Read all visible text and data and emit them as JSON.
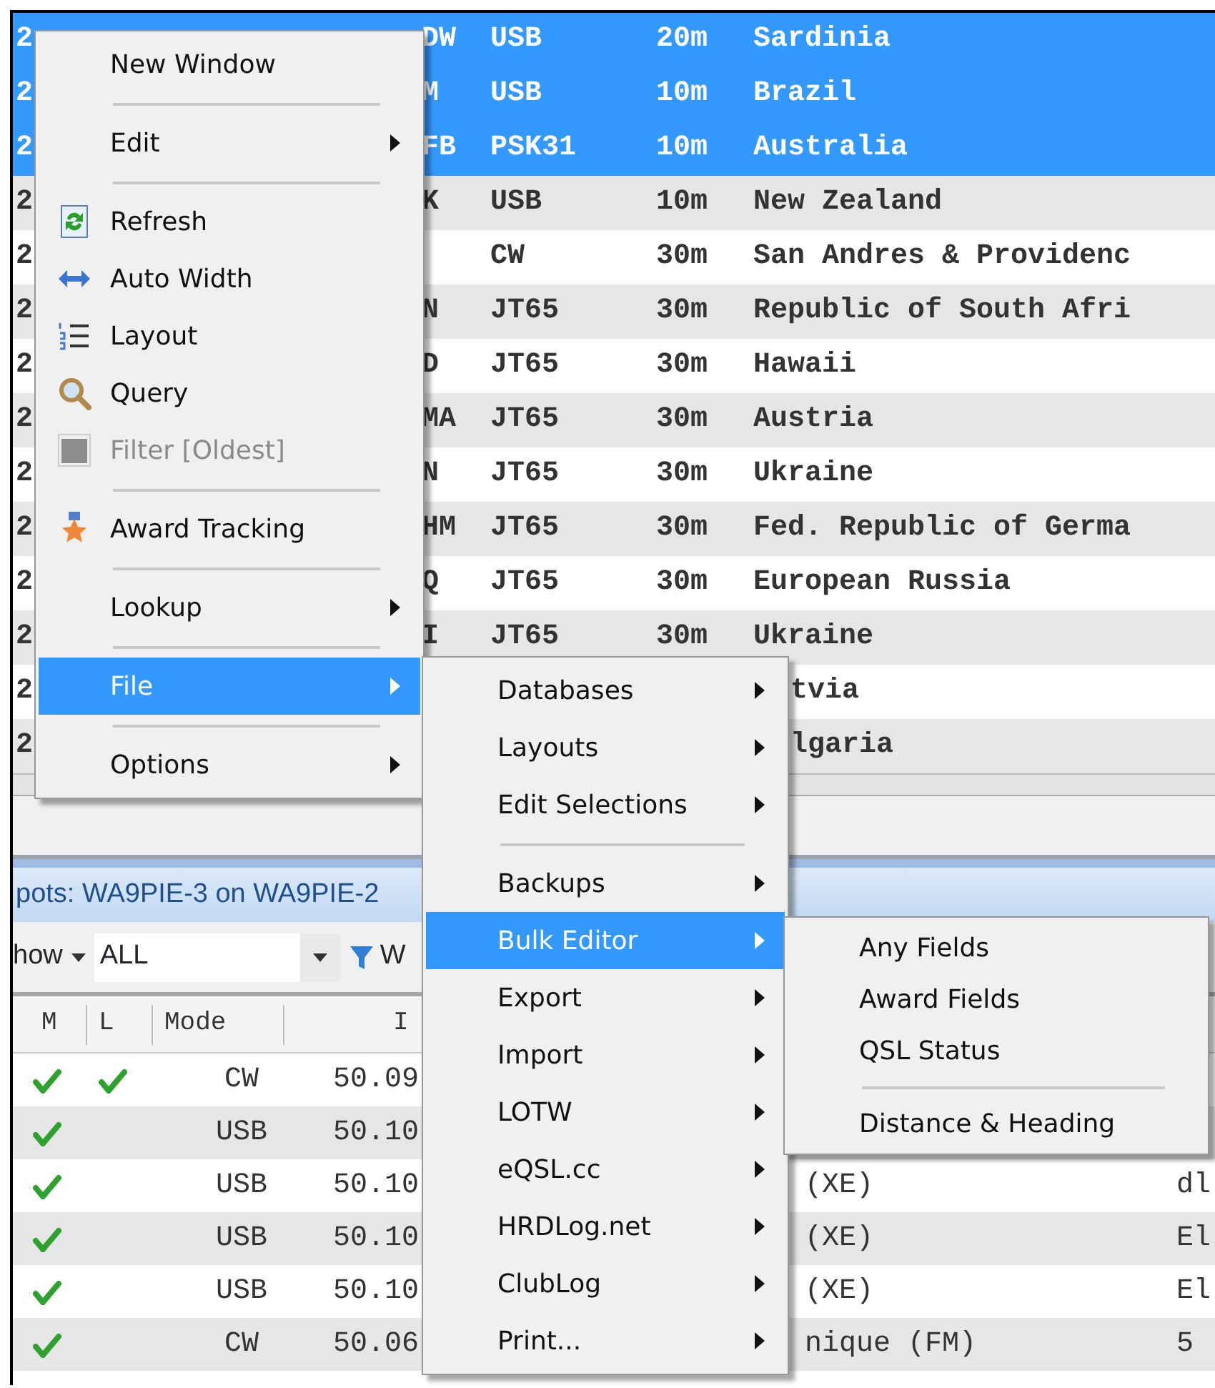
{
  "log_table": {
    "rows": [
      {
        "kind": "full",
        "column_1": "2",
        "call": "DW",
        "mode": "USB",
        "band": "20m",
        "country": "Sardinia",
        "selected": true
      },
      {
        "kind": "full",
        "column_1": "2",
        "call": "M",
        "mode": "USB",
        "band": "10m",
        "country": "Brazil",
        "selected": true
      },
      {
        "kind": "full",
        "column_1": "2",
        "call": "FB",
        "mode": "PSK31",
        "band": "10m",
        "country": "Australia",
        "selected": true
      },
      {
        "kind": "full",
        "column_1": "2",
        "call": "K",
        "mode": "USB",
        "band": "10m",
        "country": "New Zealand",
        "selected": false
      },
      {
        "kind": "full",
        "column_1": "2",
        "call": "",
        "mode": "CW",
        "band": "30m",
        "country": "San Andres & Providenc",
        "selected": false
      },
      {
        "kind": "full",
        "column_1": "2",
        "call": "N",
        "mode": "JT65",
        "band": "30m",
        "country": "Republic of South Afri",
        "selected": false
      },
      {
        "kind": "full",
        "column_1": "2",
        "call": "D",
        "mode": "JT65",
        "band": "30m",
        "country": "Hawaii",
        "selected": false
      },
      {
        "kind": "full",
        "column_1": "2",
        "call": "MA",
        "mode": "JT65",
        "band": "30m",
        "country": "Austria",
        "selected": false
      },
      {
        "kind": "full",
        "column_1": "2",
        "call": "N",
        "mode": "JT65",
        "band": "30m",
        "country": "Ukraine",
        "selected": false
      },
      {
        "kind": "full",
        "column_1": "2",
        "call": "HM",
        "mode": "JT65",
        "band": "30m",
        "country": "Fed. Republic of Germa",
        "selected": false
      },
      {
        "kind": "full",
        "column_1": "2",
        "call": "Q",
        "mode": "JT65",
        "band": "30m",
        "country": "European Russia",
        "selected": false
      },
      {
        "kind": "full",
        "column_1": "2",
        "call": "I",
        "mode": "JT65",
        "band": "30m",
        "country": "Ukraine",
        "selected": false
      },
      {
        "kind": "partial",
        "column_1": "2",
        "country": "tvia",
        "selected": false
      },
      {
        "kind": "partial",
        "column_1": "2",
        "country": "lgaria",
        "selected": false
      }
    ]
  },
  "spots_panel": {
    "title": "pots: WA9PIE-3 on WA9PIE-2",
    "show_label": "how",
    "filter_value": "ALL",
    "filter_button": "W",
    "columns": [
      "M",
      "L",
      "Mode",
      "I"
    ],
    "rows": [
      {
        "m": true,
        "l": true,
        "mode": "CW",
        "freq": "50.09",
        "country": "",
        "column_6": ""
      },
      {
        "m": true,
        "l": false,
        "mode": "USB",
        "freq": "50.10",
        "country": "",
        "column_6": ""
      },
      {
        "m": true,
        "l": false,
        "mode": "USB",
        "freq": "50.10",
        "country": "(XE)",
        "column_6": "dl"
      },
      {
        "m": true,
        "l": false,
        "mode": "USB",
        "freq": "50.10",
        "country": "(XE)",
        "column_6": "El"
      },
      {
        "m": true,
        "l": false,
        "mode": "USB",
        "freq": "50.10",
        "country": "(XE)",
        "column_6": "El"
      },
      {
        "m": true,
        "l": false,
        "mode": "CW",
        "freq": "50.06",
        "country": "nique (FM)",
        "column_6": "5"
      }
    ]
  },
  "menus": [
    {
      "items": [
        {
          "kind": "item",
          "label": "New Window",
          "selected": false,
          "disabled": false,
          "submenu": false
        },
        {
          "kind": "separator"
        },
        {
          "kind": "item",
          "label": "Edit",
          "selected": false,
          "disabled": false,
          "submenu": true
        },
        {
          "kind": "separator"
        },
        {
          "kind": "item",
          "label": "Refresh",
          "selected": false,
          "disabled": false,
          "submenu": false
        },
        {
          "kind": "item",
          "label": "Auto Width",
          "selected": false,
          "disabled": false,
          "submenu": false
        },
        {
          "kind": "item",
          "label": "Layout",
          "selected": false,
          "disabled": false,
          "submenu": false
        },
        {
          "kind": "item",
          "label": "Query",
          "selected": false,
          "disabled": false,
          "submenu": false
        },
        {
          "kind": "item",
          "label": "Filter [Oldest]",
          "selected": false,
          "disabled": true,
          "submenu": false
        },
        {
          "kind": "separator"
        },
        {
          "kind": "item",
          "label": "Award Tracking",
          "selected": false,
          "disabled": false,
          "submenu": false
        },
        {
          "kind": "separator"
        },
        {
          "kind": "item",
          "label": "Lookup",
          "selected": false,
          "disabled": false,
          "submenu": true
        },
        {
          "kind": "separator"
        },
        {
          "kind": "item",
          "label": "File",
          "selected": true,
          "disabled": false,
          "submenu": true
        },
        {
          "kind": "separator"
        },
        {
          "kind": "item",
          "label": "Options",
          "selected": false,
          "disabled": false,
          "submenu": true
        }
      ]
    },
    {
      "items": [
        {
          "kind": "item",
          "label": "Databases",
          "selected": false,
          "disabled": false,
          "submenu": true
        },
        {
          "kind": "item",
          "label": "Layouts",
          "selected": false,
          "disabled": false,
          "submenu": true
        },
        {
          "kind": "item",
          "label": "Edit Selections",
          "selected": false,
          "disabled": false,
          "submenu": true
        },
        {
          "kind": "separator"
        },
        {
          "kind": "item",
          "label": "Backups",
          "selected": false,
          "disabled": false,
          "submenu": true
        },
        {
          "kind": "item",
          "label": "Bulk Editor",
          "selected": true,
          "disabled": false,
          "submenu": true
        },
        {
          "kind": "item",
          "label": "Export",
          "selected": false,
          "disabled": false,
          "submenu": true
        },
        {
          "kind": "item",
          "label": "Import",
          "selected": false,
          "disabled": false,
          "submenu": true
        },
        {
          "kind": "item",
          "label": "LOTW",
          "selected": false,
          "disabled": false,
          "submenu": true
        },
        {
          "kind": "item",
          "label": "eQSL.cc",
          "selected": false,
          "disabled": false,
          "submenu": true
        },
        {
          "kind": "item",
          "label": "HRDLog.net",
          "selected": false,
          "disabled": false,
          "submenu": true
        },
        {
          "kind": "item",
          "label": "ClubLog",
          "selected": false,
          "disabled": false,
          "submenu": true
        },
        {
          "kind": "item",
          "label": "Print...",
          "selected": false,
          "disabled": false,
          "submenu": true
        }
      ]
    },
    {
      "items": [
        {
          "kind": "item",
          "label": "Any Fields",
          "selected": false,
          "disabled": false,
          "submenu": false
        },
        {
          "kind": "item",
          "label": "Award Fields",
          "selected": false,
          "disabled": false,
          "submenu": false
        },
        {
          "kind": "item",
          "label": "QSL Status",
          "selected": false,
          "disabled": false,
          "submenu": false
        },
        {
          "kind": "separator"
        },
        {
          "kind": "item",
          "label": "Distance & Heading",
          "selected": false,
          "disabled": false,
          "submenu": false
        }
      ]
    }
  ]
}
